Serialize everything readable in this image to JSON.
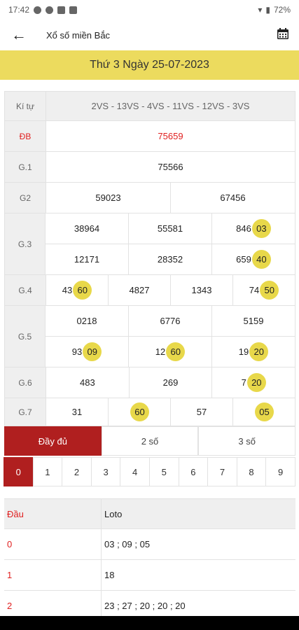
{
  "status": {
    "time": "17:42",
    "battery": "72%"
  },
  "app_bar": {
    "title": "Xổ số miền Bắc"
  },
  "date": "Thứ 3 Ngày 25-07-2023",
  "results": {
    "header_label": "Kí tự",
    "header_value": "2VS - 13VS - 4VS - 11VS - 12VS - 3VS",
    "db": {
      "label": "ĐB",
      "value": "75659"
    },
    "g1": {
      "label": "G.1",
      "value": "75566"
    },
    "g2": {
      "label": "G2",
      "values": [
        "59023",
        "67456"
      ]
    },
    "g3": {
      "label": "G.3",
      "values": [
        {
          "p": "38964",
          "h": ""
        },
        {
          "p": "55581",
          "h": ""
        },
        {
          "p": "846",
          "h": "03"
        },
        {
          "p": "12171",
          "h": ""
        },
        {
          "p": "28352",
          "h": ""
        },
        {
          "p": "659",
          "h": "40"
        }
      ]
    },
    "g4": {
      "label": "G.4",
      "values": [
        {
          "p": "43",
          "h": "60"
        },
        {
          "p": "4827",
          "h": ""
        },
        {
          "p": "1343",
          "h": ""
        },
        {
          "p": "74",
          "h": "50"
        }
      ]
    },
    "g5": {
      "label": "G.5",
      "values": [
        {
          "p": "0218",
          "h": ""
        },
        {
          "p": "6776",
          "h": ""
        },
        {
          "p": "5159",
          "h": ""
        },
        {
          "p": "93",
          "h": "09"
        },
        {
          "p": "12",
          "h": "60"
        },
        {
          "p": "19",
          "h": "20"
        }
      ]
    },
    "g6": {
      "label": "G.6",
      "values": [
        {
          "p": "483",
          "h": ""
        },
        {
          "p": "269",
          "h": ""
        },
        {
          "p": "7",
          "h": "20"
        }
      ]
    },
    "g7": {
      "label": "G.7",
      "values": [
        {
          "p": "31",
          "h": ""
        },
        {
          "p": "",
          "h": "60"
        },
        {
          "p": "57",
          "h": ""
        },
        {
          "p": "",
          "h": "05"
        }
      ]
    }
  },
  "tabs": [
    "Đầy đủ",
    "2 số",
    "3 số"
  ],
  "digits": [
    "0",
    "1",
    "2",
    "3",
    "4",
    "5",
    "6",
    "7",
    "8",
    "9"
  ],
  "loto": {
    "header": {
      "c1": "Đầu",
      "c2": "Loto"
    },
    "rows": [
      {
        "c1": "0",
        "c2": "03 ; 09 ; 05"
      },
      {
        "c1": "1",
        "c2": "18"
      },
      {
        "c1": "2",
        "c2": "23 ; 27 ; 20 ; 20 ; 20"
      }
    ]
  }
}
